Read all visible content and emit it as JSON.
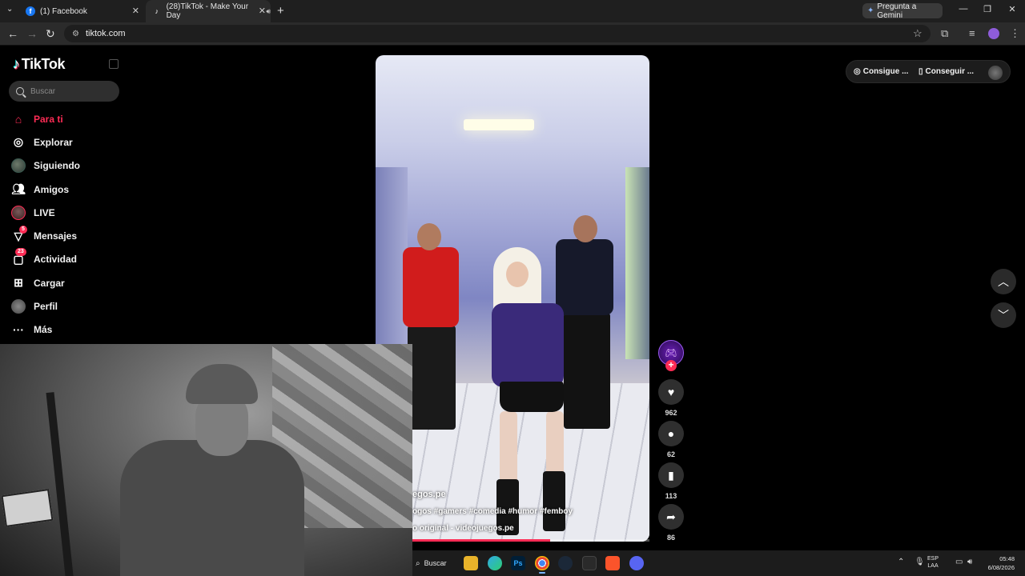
{
  "browser": {
    "tabs": [
      {
        "title": "(1) Facebook",
        "icon": "facebook-icon",
        "active": false
      },
      {
        "title": "(28)TikTok - Make Your Day",
        "icon": "tiktok-icon",
        "active": true
      }
    ],
    "gemini_label": "Pregunta a Gemini",
    "url": "tiktok.com"
  },
  "tiktok": {
    "logo_text": "TikTok",
    "search_placeholder": "Buscar",
    "nav": [
      {
        "label": "Para ti",
        "icon": "home-icon",
        "active": true
      },
      {
        "label": "Explorar",
        "icon": "compass-icon"
      },
      {
        "label": "Siguiendo",
        "icon": "following-avatar-icon"
      },
      {
        "label": "Amigos",
        "icon": "friends-icon"
      },
      {
        "label": "LIVE",
        "icon": "live-icon"
      },
      {
        "label": "Mensajes",
        "icon": "messages-icon",
        "badge": "5"
      },
      {
        "label": "Actividad",
        "icon": "activity-icon",
        "badge": "23"
      },
      {
        "label": "Cargar",
        "icon": "upload-icon"
      },
      {
        "label": "Perfil",
        "icon": "profile-icon"
      },
      {
        "label": "Más",
        "icon": "more-icon"
      }
    ],
    "top_right": {
      "coins_label": "Consigue ...",
      "app_label": "Conseguir ..."
    },
    "video": {
      "author_partial": "egos.pe",
      "hashtags_partial": "ogos #gamers #comedia #humor #femboy",
      "sound_partial": "o original - videojuegos.pe",
      "progress": 0.58
    },
    "actions": {
      "likes": "962",
      "comments": "62",
      "saves": "113",
      "shares": "86"
    },
    "accent": "#fe2c55"
  },
  "taskbar": {
    "search_label": "Buscar",
    "apps": [
      "file-explorer-icon",
      "edge-icon",
      "photoshop-icon",
      "chrome-icon",
      "steam-icon",
      "terminal-icon",
      "brave-icon",
      "discord-icon"
    ],
    "ps_label": "Ps",
    "lang_top": "ESP",
    "lang_bottom": "LAA",
    "time": "05:48",
    "date": "6/08/2026"
  }
}
